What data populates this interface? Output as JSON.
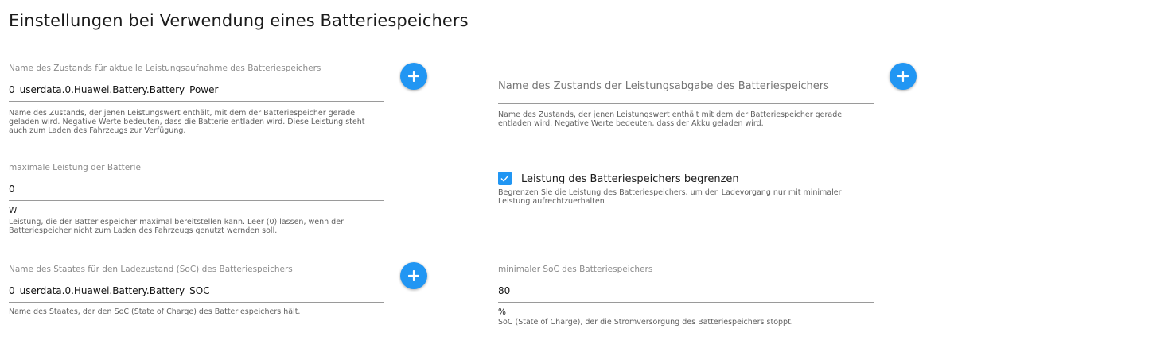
{
  "page": {
    "title": "Einstellungen bei Verwendung eines Batteriespeichers"
  },
  "power_state": {
    "label": "Name des Zustands für aktuelle Leistungsaufnahme des Batteriespeichers",
    "value": "0_userdata.0.Huawei.Battery.Battery_Power",
    "help_1": "Name des Zustands, der jenen Leistungswert enthält, mit dem der Batteriespeicher gerade",
    "help_2": "geladen wird. Negative Werte bedeuten, dass die Batterie entladen wird. Diese Leistung steht",
    "help_3": "auch zum Laden des Fahrzeugs zur Verfügung.",
    "icon": "plus-icon"
  },
  "output_state": {
    "placeholder": "Name des Zustands der Leistungsabgabe des Batteriespeichers",
    "value": "",
    "help_1": "Name des Zustands, der jenen Leistungswert enthält mit dem der Batteriespeicher gerade",
    "help_2": "entladen wird. Negative Werte bedeuten, dass der Akku geladen wird.",
    "icon": "plus-icon"
  },
  "max_power": {
    "label": "maximale Leistung der Batterie",
    "value": "0",
    "unit": "W",
    "help_1": "Leistung, die der Batteriespeicher maximal bereitstellen kann. Leer (0) lassen, wenn der",
    "help_2": "Batteriespeicher nicht zum Laden des Fahrzeugs genutzt wernden soll."
  },
  "limit_power": {
    "checked": true,
    "label": "Leistung des Batteriespeichers begrenzen",
    "help_1": "Begrenzen Sie die Leistung des Batteriespeichers, um den Ladevorgang nur mit minimaler",
    "help_2": "Leistung aufrechtzuerhalten",
    "icon": "check-icon"
  },
  "soc_state": {
    "label": "Name des Staates für den Ladezustand (SoC) des Batteriespeichers",
    "value": "0_userdata.0.Huawei.Battery.Battery_SOC",
    "help": "Name des Staates, der den SoC (State of Charge) des Batteriespeichers hält.",
    "icon": "plus-icon"
  },
  "min_soc": {
    "label": "minimaler SoC des Batteriespeichers",
    "value": "80",
    "unit": "%",
    "help": "SoC (State of Charge), der die Stromversorgung des Batteriespeichers stoppt."
  },
  "colors": {
    "accent": "#2196f3",
    "label": "#8a8a8a",
    "underline": "#9a9a9a"
  }
}
